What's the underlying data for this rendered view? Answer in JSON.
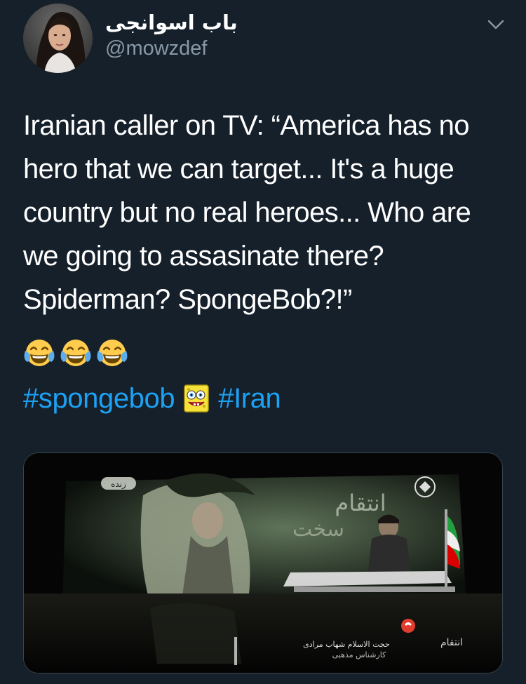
{
  "tweet": {
    "author": {
      "display_name": "باب اسوانجی",
      "handle": "@mowzdef"
    },
    "text_lines": [
      "Iranian caller on TV: “America has no",
      "hero that we can target... It's a huge",
      "country but no real heroes... Who are",
      "we going to assasinate there?",
      "Spiderman? SpongeBob?!”"
    ],
    "emojis": [
      "face-with-tears-of-joy",
      "face-with-tears-of-joy",
      "face-with-tears-of-joy"
    ],
    "hashtags": [
      "#spongebob",
      "#Iran"
    ],
    "hashtag_emoji": "spongebob-emoji",
    "media": {
      "overlay_badge": "زنده",
      "screen_title_line1": "انتقام",
      "screen_title_line2": "سخت",
      "lower_third_line1": "حجت الاسلام شهاب مرادی",
      "lower_third_line2": "کارشناس مذهبی",
      "corner_text": "انتقام"
    }
  },
  "colors": {
    "background": "#15202b",
    "text": "#ffffff",
    "secondary": "#8899a6",
    "link": "#1da1f2",
    "border": "#38444d"
  }
}
